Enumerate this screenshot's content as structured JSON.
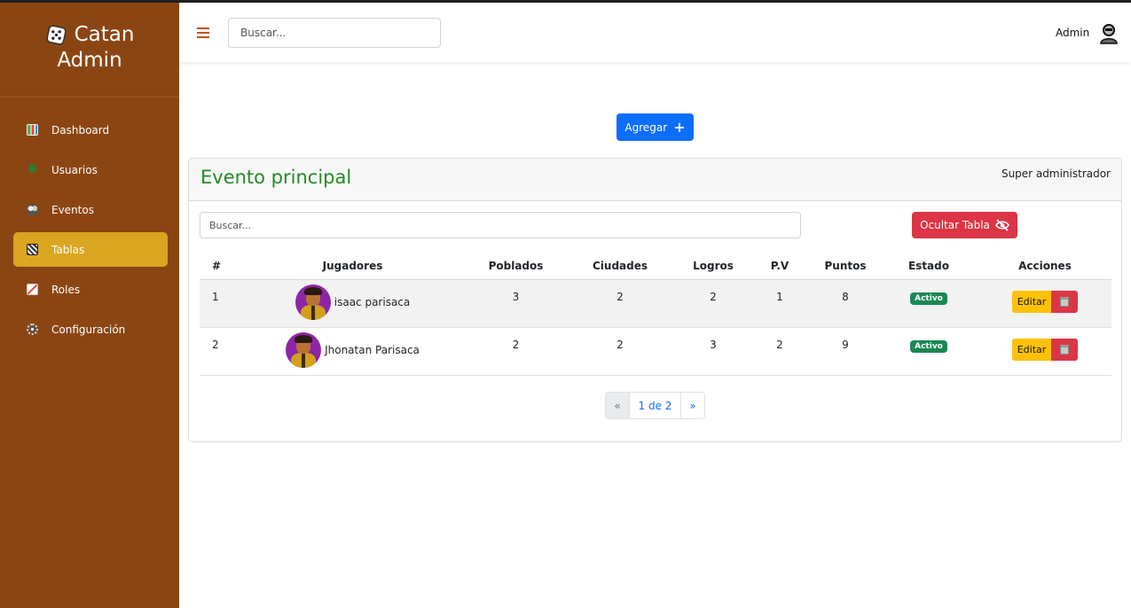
{
  "app": {
    "name_line1": "Catan",
    "name_line2": "Admin"
  },
  "sidebar": {
    "items": [
      {
        "label": "Dashboard",
        "icon": "chart-icon"
      },
      {
        "label": "Usuarios",
        "icon": "users-icon"
      },
      {
        "label": "Eventos",
        "icon": "events-icon"
      },
      {
        "label": "Tablas",
        "icon": "table-icon",
        "active": true
      },
      {
        "label": "Roles",
        "icon": "roles-icon"
      },
      {
        "label": "Configuración",
        "icon": "gear-icon"
      }
    ]
  },
  "header": {
    "search_placeholder": "Buscar...",
    "user_label": "Admin"
  },
  "main": {
    "add_button_label": "Agregar",
    "card": {
      "title": "Evento principal",
      "role": "Super administrador",
      "search_placeholder": "Buscar...",
      "hide_button_label": "Ocultar Tabla",
      "columns": [
        "#",
        "Jugadores",
        "Poblados",
        "Ciudades",
        "Logros",
        "P.V",
        "Puntos",
        "Estado",
        "Acciones"
      ],
      "rows": [
        {
          "num": "1",
          "player": "isaac parisaca",
          "poblados": "3",
          "ciudades": "2",
          "logros": "2",
          "pv": "1",
          "puntos": "8",
          "estado": "Activo",
          "edit": "Editar"
        },
        {
          "num": "2",
          "player": "Jhonatan Parisaca",
          "poblados": "2",
          "ciudades": "2",
          "logros": "3",
          "pv": "2",
          "puntos": "9",
          "estado": "Activo",
          "edit": "Editar"
        }
      ],
      "pagination": {
        "prev": "«",
        "info": "1 de 2",
        "next": "»"
      }
    }
  },
  "colors": {
    "sidebar_bg": "#8b4513",
    "sidebar_active": "#daa520",
    "primary": "#0d6efd",
    "danger": "#dc3545",
    "warning": "#ffc107",
    "success": "#198754",
    "title_green": "#228b22"
  }
}
